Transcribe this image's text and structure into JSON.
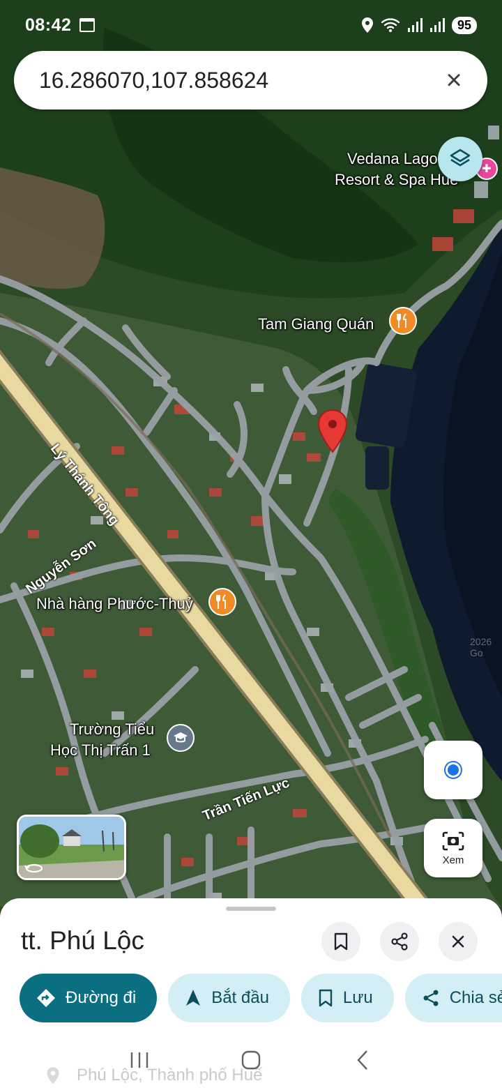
{
  "status_bar": {
    "time": "08:42",
    "battery": "95",
    "icons": [
      "calendar-icon",
      "location-icon",
      "wifi-icon",
      "signal-icon",
      "signal-icon"
    ]
  },
  "search": {
    "query": "16.286070,107.858624",
    "clear_icon": "close-icon"
  },
  "map": {
    "labels": {
      "vedana_line1": "Vedana Lago",
      "vedana_line2": "Resort & Spa Huế",
      "tam_giang": "Tam Giang Quán",
      "phuoc_thuy": "Nhà hàng Phước-Thuỷ",
      "school_line1": "Trường Tiểu",
      "school_line2": "Học Thị Trấn 1"
    },
    "roads": {
      "ly_thanh_tong": "Lý Thánh Tông",
      "nguyen_son": "Nguyễn Sơn",
      "tran_tien_luc": "Trần Tiến Lực"
    },
    "watermark": "2026 Go",
    "colors": {
      "pin": "#e53935",
      "highway": "#e8d9a0",
      "road": "#9aa0a6",
      "water": "#0e1a2e",
      "forest": "#1f4a1f",
      "food_poi": "#f08a24",
      "school_poi": "#67788a",
      "hotel_poi": "#e8469a"
    }
  },
  "floating": {
    "layers_icon": "layers-icon",
    "lens_label": "Xem"
  },
  "sheet": {
    "title": "tt. Phú Lộc",
    "actions": [
      {
        "label": "Đường đi",
        "icon": "directions-icon"
      },
      {
        "label": "Bắt đầu",
        "icon": "navigation-arrow-icon"
      },
      {
        "label": "Lưu",
        "icon": "bookmark-icon"
      },
      {
        "label": "Chia sẻ",
        "icon": "share-icon"
      }
    ],
    "address": "Phú Lộc, Thành phố Huế"
  },
  "accent_color": "#0b6f82"
}
